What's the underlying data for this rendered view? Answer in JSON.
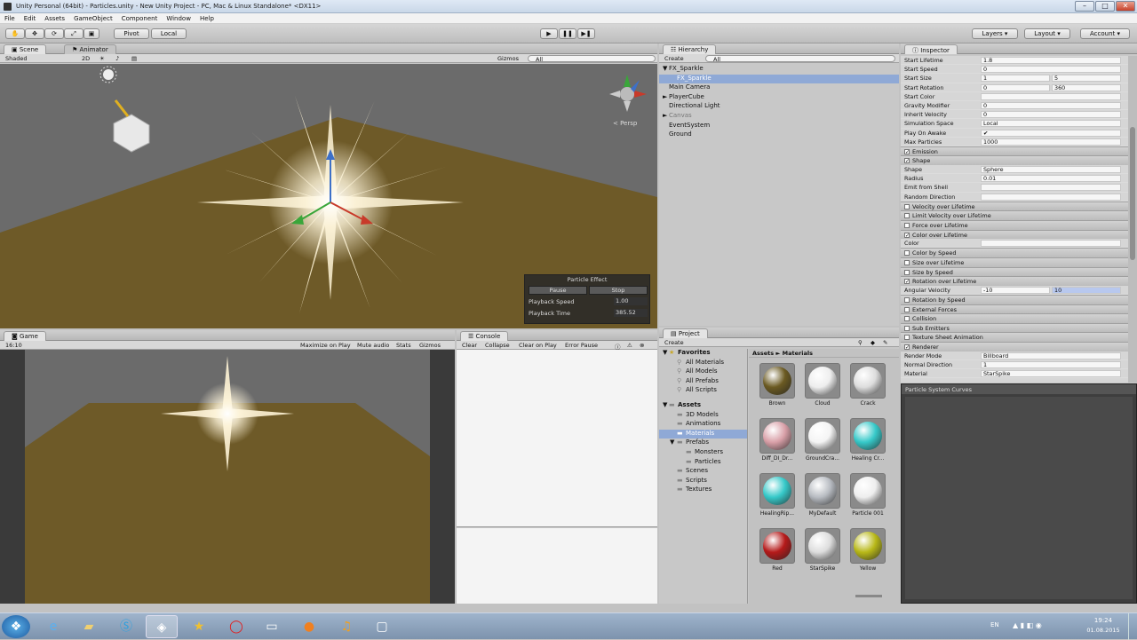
{
  "window": {
    "title": "Unity Personal (64bit) - Particles.unity - New Unity Project - PC, Mac & Linux Standalone* <DX11>",
    "minimize": "–",
    "maximize": "□",
    "close": "✕"
  },
  "menu": [
    "File",
    "Edit",
    "Assets",
    "GameObject",
    "Component",
    "Window",
    "Help"
  ],
  "toolbar": {
    "pivot": "Pivot",
    "local": "Local",
    "play": "▶",
    "pause": "❚❚",
    "step": "▶❚",
    "layers": "Layers",
    "layout": "Layout",
    "account": "Account"
  },
  "scene": {
    "tab": "Scene",
    "tab2": "Animator",
    "shading": "Shaded",
    "mode": "2D",
    "gizmos": "Gizmos",
    "search": "All",
    "persp": "< Persp",
    "particle_effect": {
      "title": "Particle Effect",
      "pause": "Pause",
      "stop": "Stop",
      "speed_label": "Playback Speed",
      "speed": "1.00",
      "time_label": "Playback Time",
      "time": "385.52"
    }
  },
  "game": {
    "tab": "Game",
    "aspect": "16:10",
    "maximize": "Maximize on Play",
    "mute": "Mute audio",
    "stats": "Stats",
    "gizmos": "Gizmos"
  },
  "console": {
    "tab": "Console",
    "clear": "Clear",
    "collapse": "Collapse",
    "clear_on_play": "Clear on Play",
    "error_pause": "Error Pause"
  },
  "hierarchy": {
    "tab": "Hierarchy",
    "create": "Create",
    "search": "All",
    "items": [
      {
        "label": "FX_Sparkle",
        "indent": 0,
        "arrow": "▼"
      },
      {
        "label": "FX_Sparkle",
        "indent": 2,
        "arrow": "",
        "selected": true
      },
      {
        "label": "Main Camera",
        "indent": 1,
        "arrow": ""
      },
      {
        "label": "PlayerCube",
        "indent": 0,
        "arrow": "►"
      },
      {
        "label": "Directional Light",
        "indent": 1,
        "arrow": ""
      },
      {
        "label": "Canvas",
        "indent": 0,
        "arrow": "►",
        "grey": true
      },
      {
        "label": "EventSystem",
        "indent": 1,
        "arrow": ""
      },
      {
        "label": "Ground",
        "indent": 1,
        "arrow": ""
      }
    ]
  },
  "inspector": {
    "tab": "Inspector",
    "rows": [
      {
        "label": "Start Lifetime",
        "value": "1.8"
      },
      {
        "label": "Start Speed",
        "value": "0"
      },
      {
        "label": "Start Size",
        "value": "1",
        "value2": "5"
      },
      {
        "label": "Start Rotation",
        "value": "0",
        "value2": "360"
      },
      {
        "label": "Start Color",
        "value": ""
      },
      {
        "label": "Gravity Modifier",
        "value": "0"
      },
      {
        "label": "Inherit Velocity",
        "value": "0"
      },
      {
        "label": "Simulation Space",
        "value": "Local"
      },
      {
        "label": "Play On Awake",
        "value": "✔"
      },
      {
        "label": "Max Particles",
        "value": "1000"
      }
    ],
    "modules": [
      {
        "label": "Emission",
        "on": true
      },
      {
        "label": "Shape",
        "on": true
      },
      {
        "label": "Shape",
        "value": "Sphere",
        "row": true
      },
      {
        "label": "Radius",
        "value": "0.01",
        "row": true
      },
      {
        "label": "Emit from Shell",
        "value": "",
        "row": true
      },
      {
        "label": "Random Direction",
        "value": "",
        "row": true
      },
      {
        "label": "Velocity over Lifetime",
        "on": false
      },
      {
        "label": "Limit Velocity over Lifetime",
        "on": false
      },
      {
        "label": "Force over Lifetime",
        "on": false
      },
      {
        "label": "Color over Lifetime",
        "on": true
      },
      {
        "label": "Color",
        "value": "",
        "row": true
      },
      {
        "label": "Color by Speed",
        "on": false
      },
      {
        "label": "Size over Lifetime",
        "on": false
      },
      {
        "label": "Size by Speed",
        "on": false
      },
      {
        "label": "Rotation over Lifetime",
        "on": true
      },
      {
        "label": "Angular Velocity",
        "value": "-10",
        "value2": "10",
        "row": true
      },
      {
        "label": "Rotation by Speed",
        "on": false
      },
      {
        "label": "External Forces",
        "on": false
      },
      {
        "label": "Collision",
        "on": false
      },
      {
        "label": "Sub Emitters",
        "on": false
      },
      {
        "label": "Texture Sheet Animation",
        "on": false
      },
      {
        "label": "Renderer",
        "on": true
      },
      {
        "label": "Render Mode",
        "value": "Billboard",
        "row": true
      },
      {
        "label": "Normal Direction",
        "value": "1",
        "row": true
      },
      {
        "label": "Material",
        "value": "StarSpike",
        "row": true
      }
    ],
    "curves_title": "Particle System Curves"
  },
  "project": {
    "tab": "Project",
    "create": "Create",
    "favorites": "Favorites",
    "fav_items": [
      "All Materials",
      "All Models",
      "All Prefabs",
      "All Scripts"
    ],
    "assets": "Assets",
    "folders": [
      {
        "label": "3D Models",
        "indent": 1
      },
      {
        "label": "Animations",
        "indent": 1
      },
      {
        "label": "Materials",
        "indent": 1,
        "selected": true
      },
      {
        "label": "Prefabs",
        "indent": 1
      },
      {
        "label": "Monsters",
        "indent": 2
      },
      {
        "label": "Particles",
        "indent": 2
      },
      {
        "label": "Scenes",
        "indent": 1
      },
      {
        "label": "Scripts",
        "indent": 1
      },
      {
        "label": "Textures",
        "indent": 1
      }
    ],
    "breadcrumb": "Assets ► Materials",
    "materials": [
      {
        "name": "Brown",
        "color": "#6b5a22"
      },
      {
        "name": "Cloud",
        "color": "#eeeeee"
      },
      {
        "name": "Crack",
        "color": "#dddddd"
      },
      {
        "name": "Diff_DI_Dr...",
        "color": "#d9a0a8"
      },
      {
        "name": "GroundCra...",
        "color": "#f4f4f4"
      },
      {
        "name": "Healing Cr...",
        "color": "#36c9c9"
      },
      {
        "name": "HealingRip...",
        "color": "#36c9c9"
      },
      {
        "name": "MyDefault",
        "color": "#b8bcc2"
      },
      {
        "name": "Particle 001",
        "color": "#eeeeee"
      },
      {
        "name": "Red",
        "color": "#b51a1a"
      },
      {
        "name": "StarSpike",
        "color": "#dddddd"
      },
      {
        "name": "Yellow",
        "color": "#b8b818"
      }
    ]
  },
  "taskbar": {
    "lang": "EN",
    "time": "19:24",
    "date": "01.08.2015"
  },
  "colors": {
    "ground": "#6e5a28",
    "sky": "#6e6e6e",
    "accent": "#3d70c8",
    "selection": "#8fa9d6"
  }
}
